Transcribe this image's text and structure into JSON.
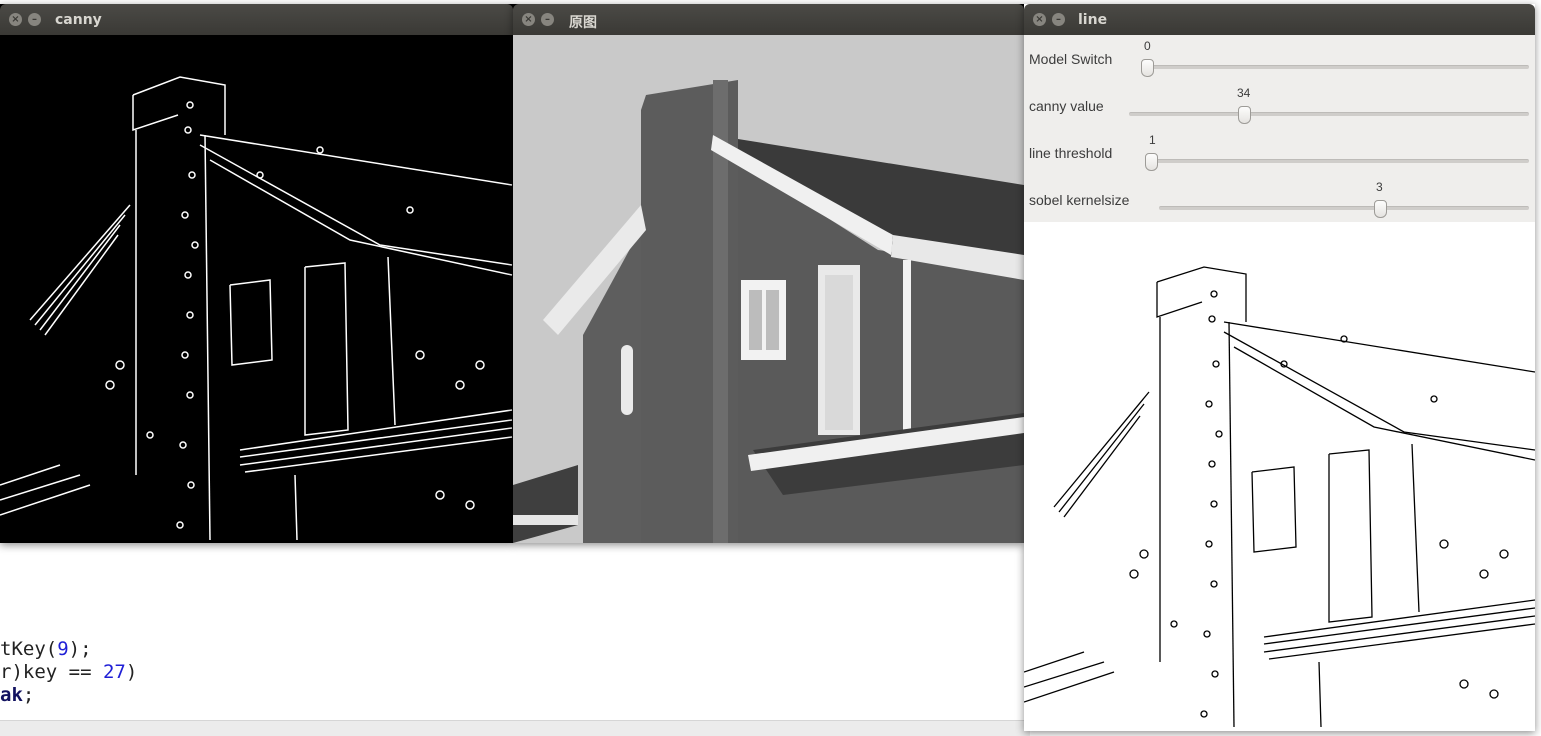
{
  "windows": {
    "canny": {
      "title": "canny"
    },
    "original": {
      "title": "原图"
    },
    "line": {
      "title": "line"
    }
  },
  "trackbars": [
    {
      "label": "Model Switch",
      "value": "0",
      "fraction": 0.0
    },
    {
      "label": "canny value",
      "value": "34",
      "fraction": 0.34
    },
    {
      "label": "line threshold",
      "value": "1",
      "fraction": 0.0
    },
    {
      "label": "sobel kernelsize",
      "value": "3",
      "fraction": 0.6
    }
  ],
  "code": {
    "line1": {
      "prefix": "tKey(",
      "num": "9",
      "suffix": ");"
    },
    "line2": {
      "prefix": "r)key == ",
      "num": "27",
      "suffix": ")"
    },
    "line3": {
      "kw": "ak",
      "suffix": ";"
    }
  }
}
